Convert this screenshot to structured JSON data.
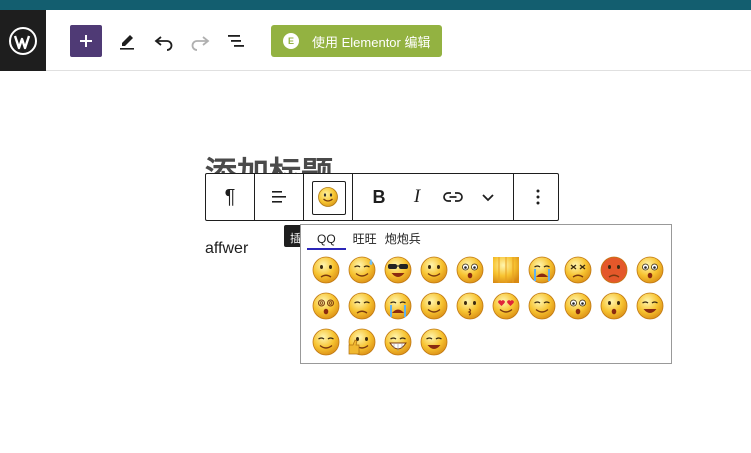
{
  "colors": {
    "top_stripe": "#135e6f",
    "wp_logo_bg": "#1e1e1e",
    "add_button_bg": "#4f3a75",
    "elementor_bg": "#93b241",
    "tab_underline": "#2b26b8"
  },
  "header": {
    "logo_icon": "wordpress-logo-icon",
    "add_icon": "plus-icon",
    "tools_icon": "pencil-icon",
    "undo_icon": "undo-icon",
    "redo_icon": "redo-icon",
    "outline_icon": "list-view-icon",
    "elementor_badge": "E",
    "elementor_label": "使用 Elementor 编辑"
  },
  "editor": {
    "title": "添加标题",
    "paragraph": "affwer",
    "tooltip": "插入表情"
  },
  "toolbar": {
    "paragraph_icon": "¶",
    "align_icon": "align-left-icon",
    "emoji_icon": "smiley-icon",
    "bold": "B",
    "italic": "I",
    "link_icon": "link-icon",
    "more_icon": "chevron-down-icon",
    "options_icon": "vertical-ellipsis-icon"
  },
  "emoji_panel": {
    "tabs": [
      {
        "label": "QQ",
        "active": true
      },
      {
        "label": "旺旺",
        "active": false
      },
      {
        "label": "炮炮兵",
        "active": false
      }
    ],
    "emojis": [
      "grumpy-face",
      "sweat-laugh-face",
      "cool-sunglasses-face",
      "smug-face",
      "surprised-face",
      "cut-off-face",
      "sobbing-face",
      "dizzy-face",
      "angry-red-face",
      "worried-face",
      "spiral-eyes-face",
      "embarrassed-face",
      "crying-face",
      "peeking-face",
      "kissing-face",
      "heart-eyes-face",
      "thinking-face",
      "shocked-face",
      "shy-face",
      "squint-grin-face",
      "blissful-face",
      "thumbs-up-face",
      "grinning-teeth-face",
      "grimace-face"
    ]
  }
}
